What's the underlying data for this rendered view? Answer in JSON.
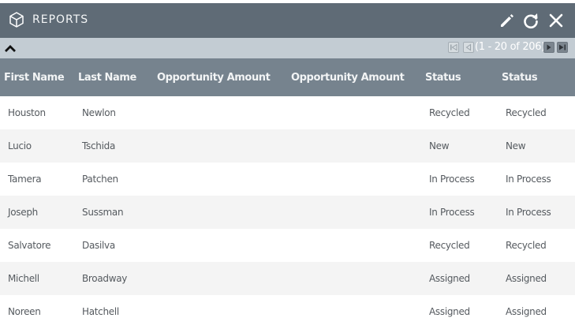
{
  "dashlet": {
    "title": "REPORTS",
    "icon": "cube-icon"
  },
  "pager": {
    "range": "(1 - 20 of 206)"
  },
  "table": {
    "columns": [
      "First Name",
      "Last Name",
      "Opportunity Amount",
      "Opportunity Amount",
      "Status",
      "Status"
    ],
    "rows": [
      {
        "first": "Houston",
        "last": "Newlon",
        "status": "Recycled",
        "status2": "Recycled"
      },
      {
        "first": "Lucio",
        "last": "Tschida",
        "status": "New",
        "status2": "New"
      },
      {
        "first": "Tamera",
        "last": "Patchen",
        "status": "In Process",
        "status2": "In Process"
      },
      {
        "first": "Joseph",
        "last": "Sussman",
        "status": "In Process",
        "status2": "In Process"
      },
      {
        "first": "Salvatore",
        "last": "Dasilva",
        "status": "Recycled",
        "status2": "Recycled"
      },
      {
        "first": "Michell",
        "last": "Broadway",
        "status": "Assigned",
        "status2": "Assigned"
      },
      {
        "first": "Noreen",
        "last": "Hatchell",
        "status": "Assigned",
        "status2": "Assigned"
      }
    ]
  },
  "colors": {
    "titlebar": "#5f6b76",
    "pager": "#c3ccd3",
    "header": "#76838e",
    "row_alt": "#f4f4f4"
  }
}
